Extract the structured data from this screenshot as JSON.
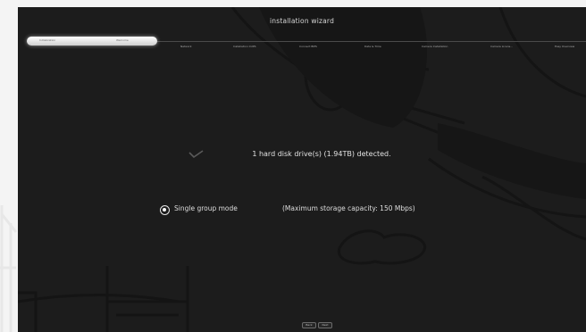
{
  "window": {
    "title": "installation wizard"
  },
  "steps": [
    {
      "label": "Initialization"
    },
    {
      "label": "Welcome"
    },
    {
      "label": "Network"
    },
    {
      "label": "Installation CUPS"
    },
    {
      "label": "Connect BMS"
    },
    {
      "label": "Date & Time"
    },
    {
      "label": "Camera Installation"
    },
    {
      "label": "Camera Licens..."
    },
    {
      "label": "Easy Overview"
    }
  ],
  "main": {
    "detected_text": "1 hard disk drive(s) (1.94TB) detected.",
    "mode_label": "Single group mode",
    "capacity_text": "(Maximum storage capacity: 150 Mbps)"
  },
  "footer": {
    "back_label": "Back",
    "next_label": "Next"
  },
  "colors": {
    "panel_bg": "#1c1c1c",
    "text": "#e2e2e2",
    "active_step": "#ffffff",
    "outer_bg": "#f4f4f4"
  }
}
